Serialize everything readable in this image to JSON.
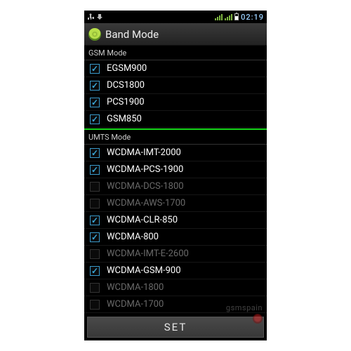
{
  "statusbar": {
    "time": "02:19",
    "icons": [
      "usb-icon",
      "download-icon",
      "signal-icon",
      "signal-icon",
      "battery-icon"
    ]
  },
  "titlebar": {
    "title": "Band Mode",
    "icon": "android-icon"
  },
  "sections": [
    {
      "label": "GSM Mode",
      "items": [
        {
          "label": "EGSM900",
          "checked": true,
          "enabled": true
        },
        {
          "label": "DCS1800",
          "checked": true,
          "enabled": true
        },
        {
          "label": "PCS1900",
          "checked": true,
          "enabled": true
        },
        {
          "label": "GSM850",
          "checked": true,
          "enabled": true
        }
      ]
    },
    {
      "label": "UMTS Mode",
      "items": [
        {
          "label": "WCDMA-IMT-2000",
          "checked": true,
          "enabled": true
        },
        {
          "label": "WCDMA-PCS-1900",
          "checked": true,
          "enabled": true
        },
        {
          "label": "WCDMA-DCS-1800",
          "checked": false,
          "enabled": false
        },
        {
          "label": "WCDMA-AWS-1700",
          "checked": false,
          "enabled": false
        },
        {
          "label": "WCDMA-CLR-850",
          "checked": true,
          "enabled": true
        },
        {
          "label": "WCDMA-800",
          "checked": true,
          "enabled": true
        },
        {
          "label": "WCDMA-IMT-E-2600",
          "checked": false,
          "enabled": false
        },
        {
          "label": "WCDMA-GSM-900",
          "checked": true,
          "enabled": true
        },
        {
          "label": "WCDMA-1800",
          "checked": false,
          "enabled": false
        },
        {
          "label": "WCDMA-1700",
          "checked": false,
          "enabled": false
        }
      ]
    }
  ],
  "footer": {
    "button_label": "SET"
  },
  "watermark": {
    "text": "gsmspain"
  },
  "colors": {
    "accent_check": "#3aa4d4",
    "divider_green": "#16d41a",
    "signal_green": "#7fb741"
  }
}
